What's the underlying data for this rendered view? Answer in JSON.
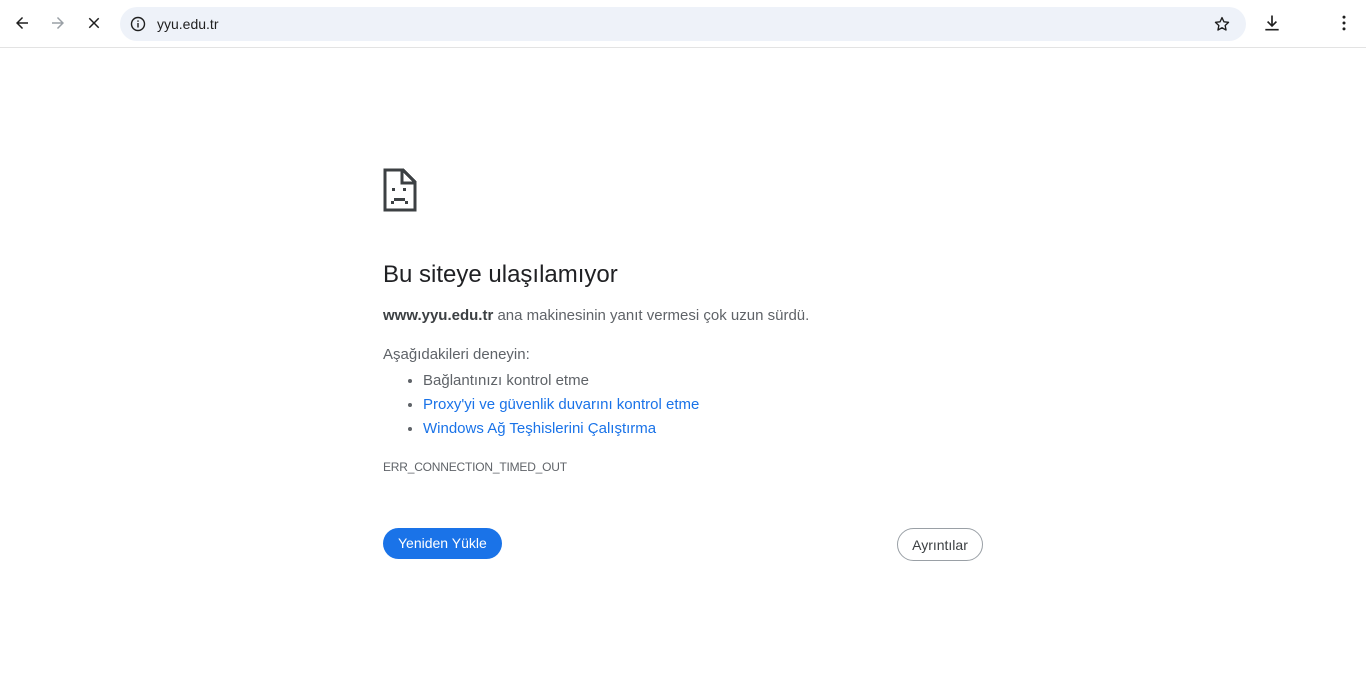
{
  "address_bar": {
    "url": "yyu.edu.tr"
  },
  "icons": {
    "back": "back-arrow-icon",
    "forward": "forward-arrow-icon",
    "stop": "stop-loading-icon",
    "info": "site-info-icon",
    "bookmark": "bookmark-star-icon",
    "download": "download-icon",
    "menu": "kebab-menu-icon",
    "error": "sad-page-icon"
  },
  "error_page": {
    "title": "Bu siteye ulaşılamıyor",
    "host": "www.yyu.edu.tr",
    "description": "ana makinesinin yanıt vermesi çok uzun sürdü.",
    "try_label": "Aşağıdakileri deneyin:",
    "suggestions": [
      "Bağlantınızı kontrol etme",
      "Proxy'yi ve güvenlik duvarını kontrol etme",
      "Windows Ağ Teşhislerini Çalıştırma"
    ],
    "error_code": "ERR_CONNECTION_TIMED_OUT",
    "reload_label": "Yeniden Yükle",
    "details_label": "Ayrıntılar"
  },
  "colors": {
    "accent": "#1a73e8",
    "omnibox_bg": "#eef2f9",
    "text": "#3c4043"
  }
}
